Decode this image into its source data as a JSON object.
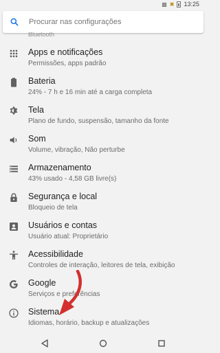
{
  "status": {
    "time": "13:25"
  },
  "search": {
    "placeholder": "Procurar nas configurações"
  },
  "cutoff_item": {
    "label": "Bluetooth"
  },
  "items": [
    {
      "title": "Apps e notificações",
      "subtitle": "Permissões, apps padrão",
      "icon": "apps-grid-icon"
    },
    {
      "title": "Bateria",
      "subtitle": "24% - 7 h e 16 min até a carga completa",
      "icon": "battery-icon"
    },
    {
      "title": "Tela",
      "subtitle": "Plano de fundo, suspensão, tamanho da fonte",
      "icon": "brightness-icon"
    },
    {
      "title": "Som",
      "subtitle": "Volume, vibração, Não perturbe",
      "icon": "volume-icon"
    },
    {
      "title": "Armazenamento",
      "subtitle": "43% usado - 4,58 GB livre(s)",
      "icon": "storage-icon"
    },
    {
      "title": "Segurança e local",
      "subtitle": "Bloqueio de tela",
      "icon": "lock-icon"
    },
    {
      "title": "Usuários e contas",
      "subtitle": "Usuário atual: Proprietário",
      "icon": "account-icon"
    },
    {
      "title": "Acessibilidade",
      "subtitle": "Controles de interação, leitores de tela, exibição",
      "icon": "accessibility-icon"
    },
    {
      "title": "Google",
      "subtitle": "Serviços e preferências",
      "icon": "google-icon"
    },
    {
      "title": "Sistema",
      "subtitle": "Idiomas, horário, backup e atualizações",
      "icon": "info-icon"
    }
  ],
  "colors": {
    "annotation_arrow": "#d32f2f",
    "icon": "#616161"
  }
}
